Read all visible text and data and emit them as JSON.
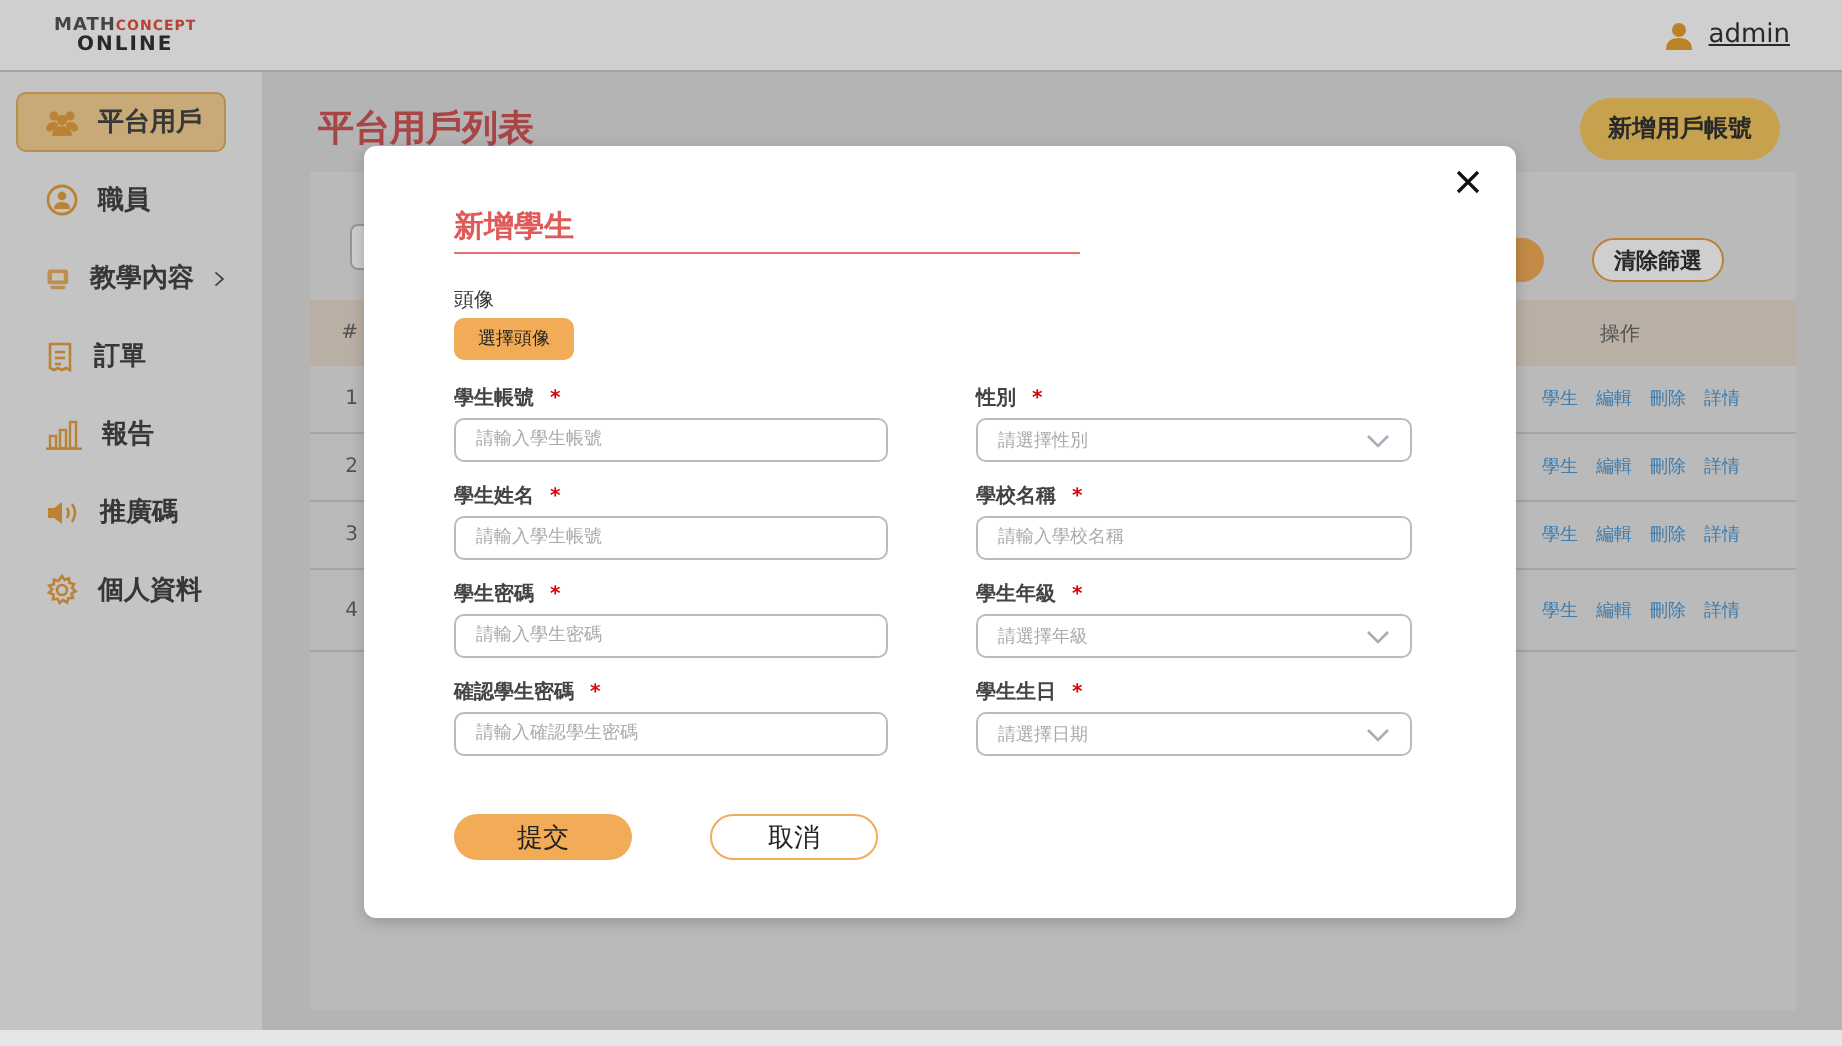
{
  "header": {
    "logo": {
      "line_1a": "MATH",
      "line_1b": "CONCEPT",
      "line_2": "ONLINE"
    },
    "user": "admin"
  },
  "sidebar": {
    "items": [
      {
        "label": "平台用戶",
        "selected": true,
        "expandable": false
      },
      {
        "label": "職員",
        "selected": false,
        "expandable": false
      },
      {
        "label": "教學內容",
        "selected": false,
        "expandable": true
      },
      {
        "label": "訂單",
        "selected": false,
        "expandable": false
      },
      {
        "label": "報告",
        "selected": false,
        "expandable": false
      },
      {
        "label": "推廣碼",
        "selected": false,
        "expandable": false
      },
      {
        "label": "個人資料",
        "selected": false,
        "expandable": false
      }
    ]
  },
  "page": {
    "title": "平台用戶列表",
    "add_button": "新增用戶帳號"
  },
  "filter": {
    "clear_button": "清除篩選"
  },
  "table": {
    "columns": [
      "#",
      "操作"
    ],
    "rows": [
      {
        "index": "1",
        "actions": [
          "學生",
          "編輯",
          "刪除",
          "詳情"
        ]
      },
      {
        "index": "2",
        "actions": [
          "學生",
          "編輯",
          "刪除",
          "詳情"
        ]
      },
      {
        "index": "3",
        "actions": [
          "學生",
          "編輯",
          "刪除",
          "詳情"
        ]
      },
      {
        "index": "4",
        "actions": [
          "學生",
          "編輯",
          "刪除",
          "詳情"
        ]
      }
    ]
  },
  "dialog": {
    "title": "新增學生",
    "avatar_label": "頭像",
    "avatar_button": "選擇頭像",
    "fields": [
      {
        "label": "學生帳號",
        "mark": "*",
        "placeholder": "請輸入學生帳號",
        "kind": "text"
      },
      {
        "label": "性別",
        "mark": "*",
        "placeholder": "請選擇性別",
        "kind": "select"
      },
      {
        "label": "學生姓名",
        "mark": "*",
        "placeholder": "請輸入學生帳號",
        "kind": "text"
      },
      {
        "label": "學校名稱",
        "mark": "*",
        "placeholder": "請輸入學校名稱",
        "kind": "text"
      },
      {
        "label": "學生密碼",
        "mark": "*",
        "placeholder": "請輸入學生密碼",
        "kind": "text"
      },
      {
        "label": "學生年級",
        "mark": "*",
        "placeholder": "請選擇年級",
        "kind": "select"
      },
      {
        "label": "確認學生密碼",
        "mark": "*",
        "placeholder": "請輸入確認學生密碼",
        "kind": "text"
      },
      {
        "label": "學生生日",
        "mark": "*",
        "placeholder": "請選擇日期",
        "kind": "select"
      }
    ],
    "submit": "提交",
    "cancel": "取消"
  }
}
